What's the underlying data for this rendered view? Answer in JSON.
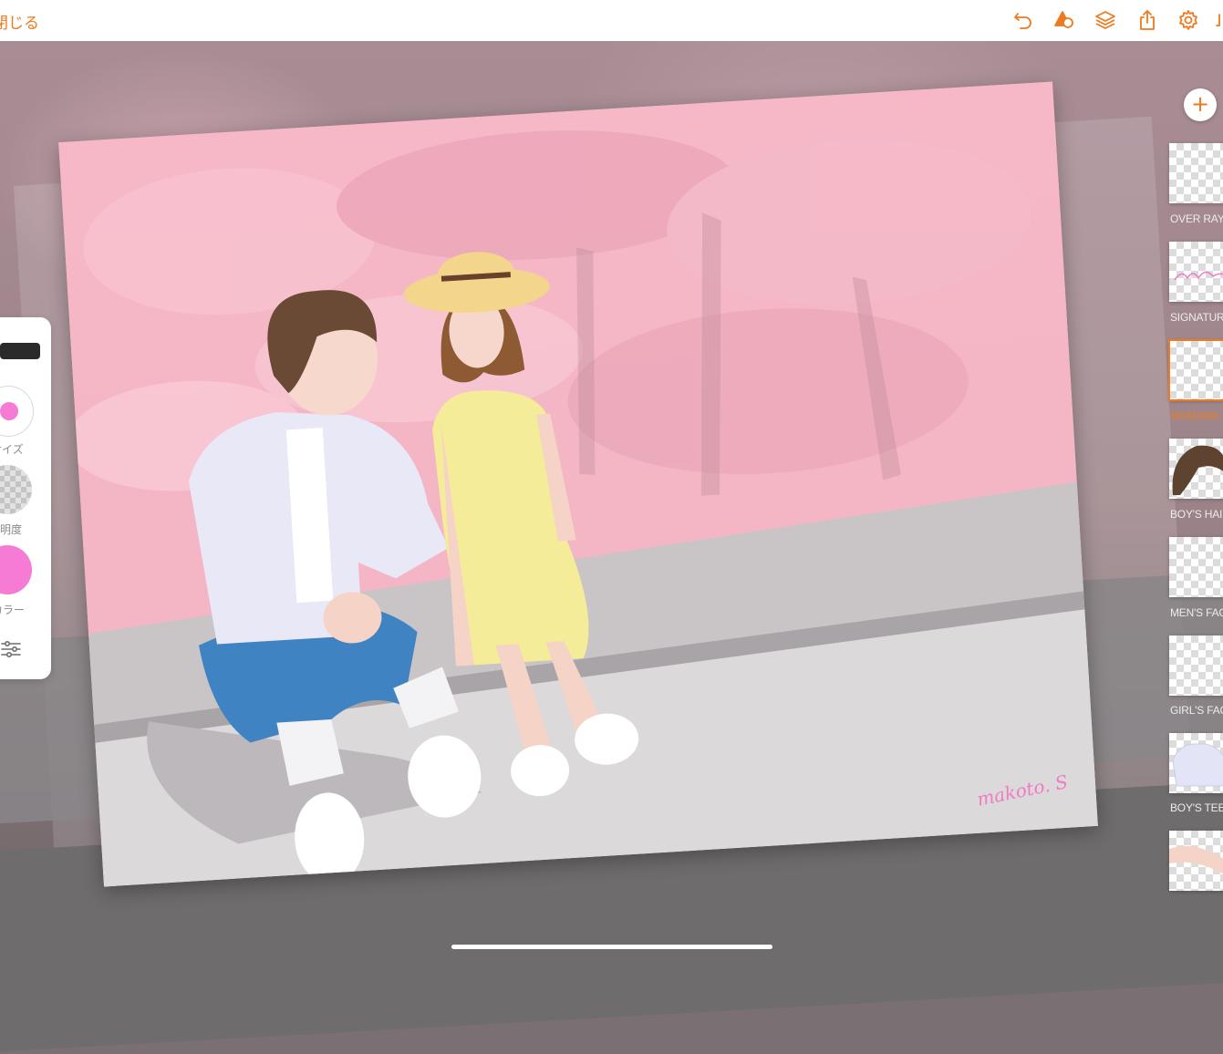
{
  "topbar": {
    "close_label": "閉じる",
    "icons": [
      "undo-icon",
      "shape-icon",
      "layers-icon",
      "share-icon",
      "settings-icon"
    ],
    "accent_color": "#ee7a1f"
  },
  "tool_panel": {
    "size_label": "サイズ",
    "opacity_label": "不透明度",
    "color_label": "カラー",
    "brush_color": "#f57bd4"
  },
  "canvas": {
    "signature": "makoto. S"
  },
  "layers": {
    "add_button": "+",
    "items": [
      {
        "name": "OVER RAY",
        "active": false
      },
      {
        "name": "SIGNATURE",
        "active": false
      },
      {
        "name": "SHADOW",
        "active": true
      },
      {
        "name": "BOY'S HAIR",
        "active": false
      },
      {
        "name": "MEN'S FACE",
        "active": false
      },
      {
        "name": "GIRL'S FACE",
        "active": false
      },
      {
        "name": "BOY'S TEE",
        "active": false
      }
    ]
  }
}
